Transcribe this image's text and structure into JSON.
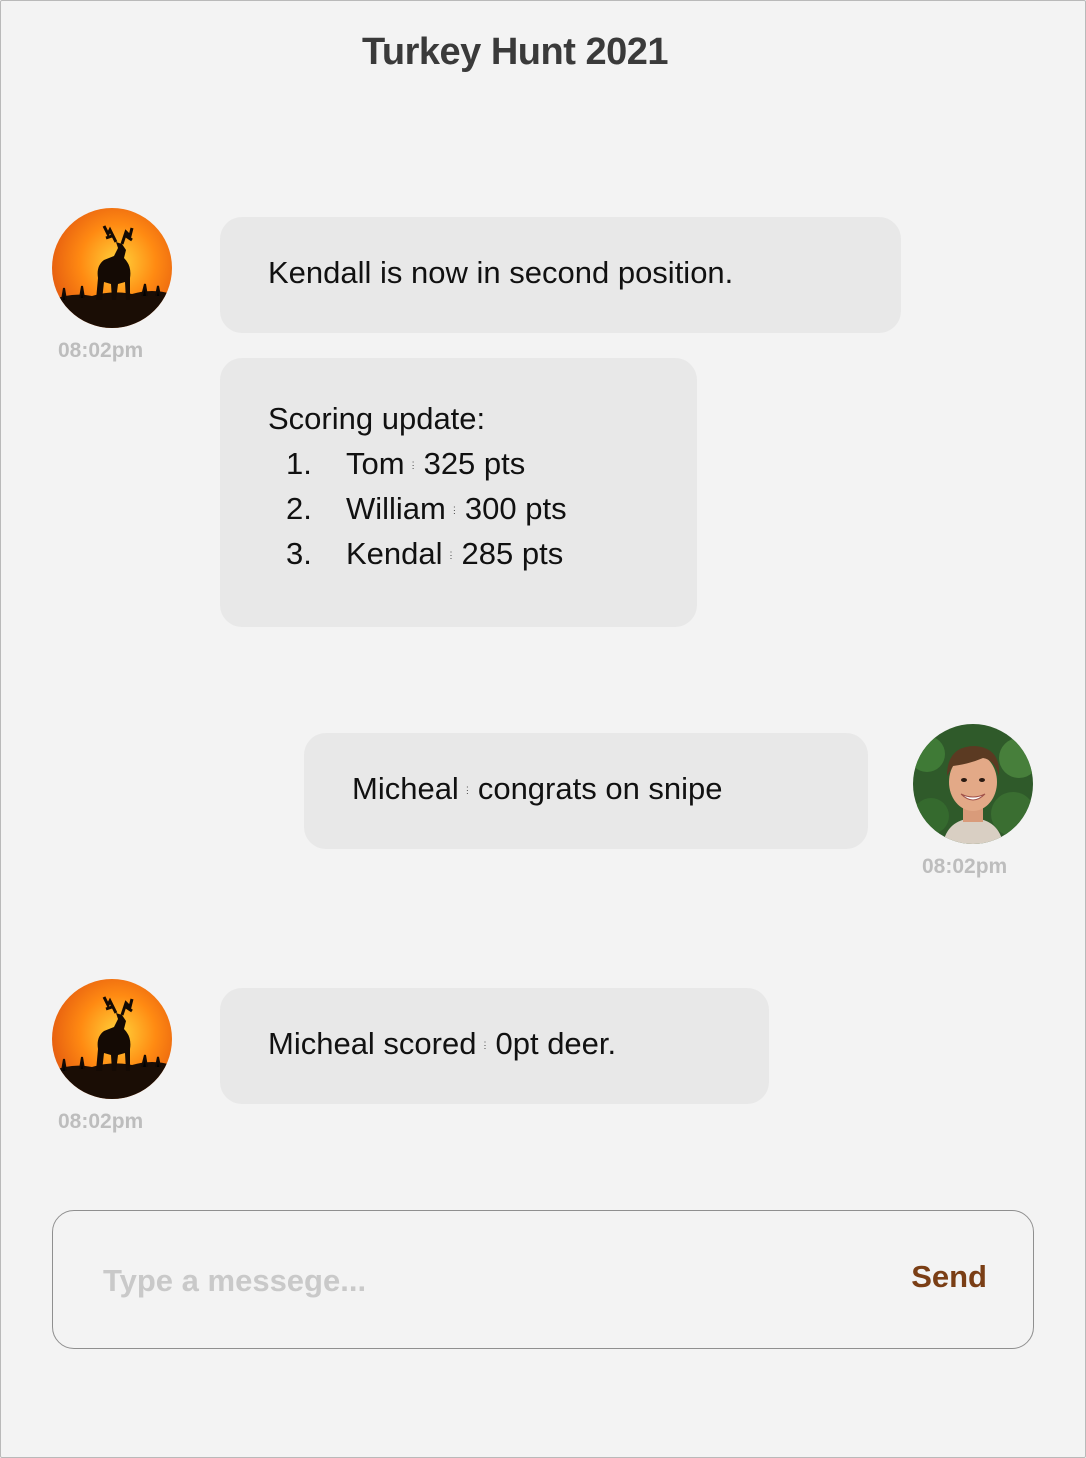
{
  "header": {
    "title": "Turkey Hunt 2021"
  },
  "messages": [
    {
      "text": "Kendall is now in second position.",
      "time": "08:02pm"
    },
    {
      "heading": "Scoring update:",
      "items": [
        {
          "num": "1.",
          "name": "Tom",
          "points": "325 pts"
        },
        {
          "num": "2.",
          "name": "William",
          "points": "300 pts"
        },
        {
          "num": "3.",
          "name": "Kendal",
          "points": "285 pts"
        }
      ]
    },
    {
      "name": "Micheal",
      "text": "congrats on snipe",
      "time": "08:02pm"
    },
    {
      "prefix": "Micheal scored",
      "text": "0pt deer.",
      "time": "08:02pm"
    }
  ],
  "composer": {
    "placeholder": "Type a messege...",
    "send_label": "Send"
  }
}
